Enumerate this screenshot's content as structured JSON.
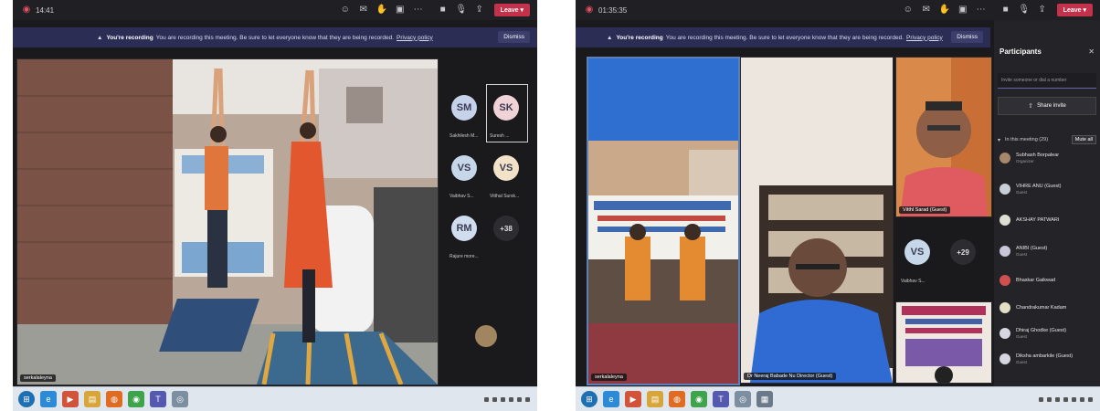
{
  "left": {
    "time": "14:41",
    "banner": {
      "title": "You're recording",
      "message": "You are recording this meeting. Be sure to let everyone know that they are being recorded.",
      "link": "Privacy policy",
      "dismiss": "Dismiss"
    },
    "leave_label": "Leave",
    "main_tile_name": "serkalaleyna",
    "avatars": [
      {
        "initials": "SM",
        "name": "Sakhilesh M...",
        "color": "#c6d2ea"
      },
      {
        "initials": "SK",
        "name": "Suresh ...",
        "color": "#efd3d6"
      },
      {
        "initials": "VS",
        "name": "Vaibhav S...",
        "color": "#c6d7e9"
      },
      {
        "initials": "VS",
        "name": "Vitthal Sursk...",
        "color": "#f1e2c8"
      },
      {
        "initials": "RM",
        "name": "Rajure more...",
        "color": "#d0ddef"
      }
    ],
    "more_count": "+38"
  },
  "right": {
    "time": "01:35:35",
    "banner": {
      "title": "You're recording",
      "message": "You are recording this meeting. Be sure to let everyone know that they are being recorded.",
      "link": "Privacy policy",
      "dismiss": "Dismiss"
    },
    "leave_label": "Leave",
    "tile_names": {
      "banner_tile": "serkalaleyna",
      "speaker_tile": "Dr Neeraj Babade Nu Director (Guest)",
      "man_tile": "Vitthl Sarad (Guest)"
    },
    "vs_avatar": {
      "initials": "VS",
      "name": "Vaibhav S..."
    },
    "more_count": "+29",
    "participants": {
      "title": "Participants",
      "invite_placeholder": "Invite someone or dial a number",
      "share_invite": "Share invite",
      "in_meeting": "In this meeting (29)",
      "mute_all": "Mute all",
      "people": [
        {
          "name": "Subhash Borpalear",
          "role": "Organizer"
        },
        {
          "name": "VIHRE ANU (Guest)",
          "role": "Guest"
        },
        {
          "name": "AKSHAY PATWARI",
          "role": ""
        },
        {
          "name": "ANIBI (Guest)",
          "role": "Guest"
        },
        {
          "name": "Bhaskar Gaikwad",
          "role": ""
        },
        {
          "name": "Chandrakumar Kadam",
          "role": ""
        },
        {
          "name": "Dhiraj Ghodke (Guest)",
          "role": "Guest"
        },
        {
          "name": "Diksha ambarkile (Guest)",
          "role": "Guest"
        }
      ]
    }
  }
}
